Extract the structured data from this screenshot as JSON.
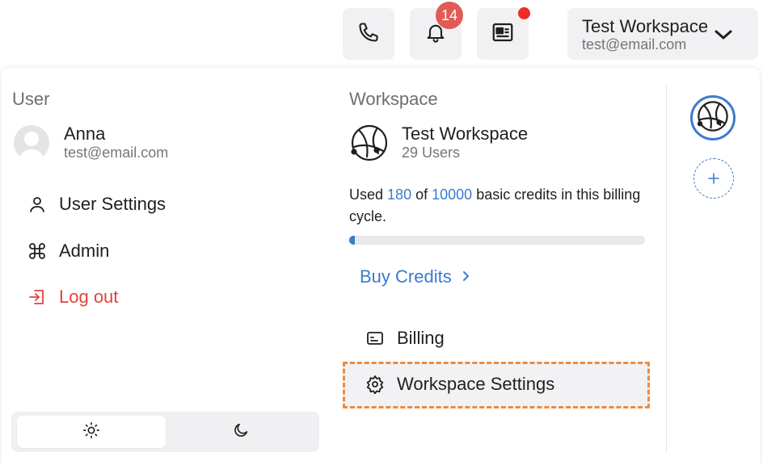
{
  "topbar": {
    "phone_icon": "phone-icon",
    "bell_icon": "bell-icon",
    "notification_count": "14",
    "news_icon": "newspaper-icon",
    "workspace_name": "Test Workspace",
    "workspace_email": "test@email.com"
  },
  "user": {
    "section_title": "User",
    "name": "Anna",
    "email": "test@email.com",
    "menu": [
      {
        "label": "User Settings",
        "icon": "user-icon"
      },
      {
        "label": "Admin",
        "icon": "command-icon"
      },
      {
        "label": "Log out",
        "icon": "logout-icon"
      }
    ]
  },
  "theme": {
    "options": [
      "light",
      "dark"
    ],
    "active": "light"
  },
  "workspace": {
    "section_title": "Workspace",
    "name": "Test Workspace",
    "users": "29 Users",
    "usage_prefix": "Used",
    "used": "180",
    "usage_of": "of",
    "total": "10000",
    "usage_suffix": "basic credits in this billing cycle.",
    "progress_fraction": 0.018,
    "buy_label": "Buy Credits",
    "menu": [
      {
        "label": "Billing",
        "icon": "billing-icon"
      },
      {
        "label": "Workspace Settings",
        "icon": "gear-icon"
      }
    ]
  },
  "colors": {
    "accent": "#3b7bd0",
    "danger": "#e4413b",
    "highlight": "#ef8a3c",
    "badge": "#e25a55"
  }
}
